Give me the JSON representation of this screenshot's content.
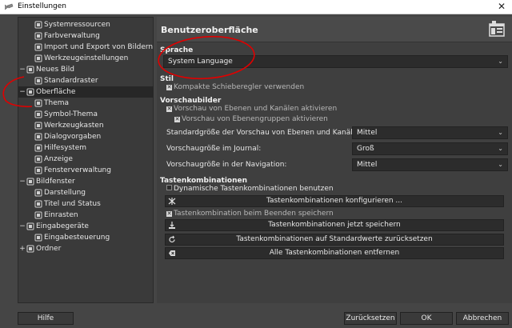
{
  "window": {
    "title": "Einstellungen",
    "close_glyph": "✕"
  },
  "tree": {
    "items": [
      {
        "label": "Systemressourcen",
        "icon": "system-resources-icon"
      },
      {
        "label": "Farbverwaltung",
        "icon": "color-management-icon"
      },
      {
        "label": "Import und Export von Bildern",
        "icon": "import-export-icon"
      },
      {
        "label": "Werkzeugeinstellungen",
        "icon": "tool-options-icon"
      },
      {
        "label": "Neues Bild",
        "icon": "new-image-icon",
        "expander": "−"
      },
      {
        "label": "Standardraster",
        "icon": "default-grid-icon"
      },
      {
        "label": "Oberfläche",
        "icon": "interface-icon",
        "expander": "−",
        "selected": true
      },
      {
        "label": "Thema",
        "icon": "theme-icon"
      },
      {
        "label": "Symbol-Thema",
        "icon": "icon-theme-icon"
      },
      {
        "label": "Werkzeugkasten",
        "icon": "toolbox-icon"
      },
      {
        "label": "Dialogvorgaben",
        "icon": "dialog-defaults-icon"
      },
      {
        "label": "Hilfesystem",
        "icon": "help-system-icon"
      },
      {
        "label": "Anzeige",
        "icon": "display-icon"
      },
      {
        "label": "Fensterverwaltung",
        "icon": "window-management-icon"
      },
      {
        "label": "Bildfenster",
        "icon": "image-window-icon",
        "expander": "−"
      },
      {
        "label": "Darstellung",
        "icon": "appearance-icon"
      },
      {
        "label": "Titel und Status",
        "icon": "title-status-icon"
      },
      {
        "label": "Einrasten",
        "icon": "snapping-icon"
      },
      {
        "label": "Eingabegeräte",
        "icon": "input-devices-icon",
        "expander": "−"
      },
      {
        "label": "Eingabesteuerung",
        "icon": "input-controllers-icon"
      },
      {
        "label": "Ordner",
        "icon": "folders-icon",
        "expander": "+"
      }
    ]
  },
  "panel": {
    "title": "Benutzeroberfläche",
    "icon": "interface-large-icon",
    "sprache": {
      "heading": "Sprache",
      "value": "System Language"
    },
    "stil": {
      "heading": "Stil",
      "compact_sliders": "Kompakte Schieberegler verwenden",
      "compact_checked": true
    },
    "vorschau": {
      "heading": "Vorschaubilder",
      "layers_channels": "Vorschau von Ebenen und Kanälen aktivieren",
      "layer_groups": "Vorschau von Ebenengruppen aktivieren",
      "default_size_label": "Standardgröße der Vorschau von Ebenen und Kanälen:",
      "default_size_value": "Mittel",
      "journal_size_label": "Vorschaugröße im Journal:",
      "journal_size_value": "Groß",
      "nav_size_label": "Vorschaugröße in der Navigation:",
      "nav_size_value": "Mittel"
    },
    "tasten": {
      "heading": "Tastenkombinationen",
      "dynamic": "Dynamische Tastenkombinationen benutzen",
      "configure": "Tastenkombinationen konfigurieren ...",
      "save_on_exit": "Tastenkombination beim Beenden speichern",
      "save_now": "Tastenkombinationen jetzt speichern",
      "reset": "Tastenkombinationen auf Standardwerte zurücksetzen",
      "remove_all": "Alle Tastenkombinationen entfernen"
    }
  },
  "footer": {
    "help": "Hilfe",
    "reset": "Zurücksetzen",
    "ok": "OK",
    "cancel": "Abbrechen"
  },
  "colors": {
    "annotation": "#e00000",
    "background": "#454545",
    "tree_bg": "#3a3a3a"
  }
}
